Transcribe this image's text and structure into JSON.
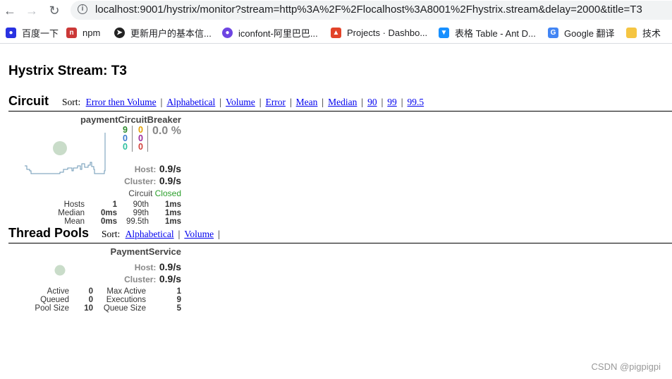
{
  "browser": {
    "url": "localhost:9001/hystrix/monitor?stream=http%3A%2F%2Flocalhost%3A8001%2Fhystrix.stream&delay=2000&title=T3",
    "bookmarks": [
      {
        "label": "百度一下",
        "icon": "baidu-icon"
      },
      {
        "label": "npm",
        "icon": "npm-icon"
      },
      {
        "label": "更新用户的基本信...",
        "icon": "site-icon"
      },
      {
        "label": "iconfont-阿里巴巴...",
        "icon": "iconfont-icon"
      },
      {
        "label": "Projects · Dashbo...",
        "icon": "gitlab-icon"
      },
      {
        "label": "表格 Table - Ant D...",
        "icon": "antd-icon"
      },
      {
        "label": "Google 翻译",
        "icon": "google-translate-icon"
      },
      {
        "label": "技术",
        "icon": "folder-icon"
      }
    ]
  },
  "page": {
    "title": "Hystrix Stream: T3",
    "watermark": "CSDN @pigpigpi"
  },
  "circuit": {
    "heading": "Circuit",
    "sort_label": "Sort:",
    "sort_links": [
      "Error then Volume",
      "Alphabetical",
      "Volume",
      "Error",
      "Mean",
      "Median",
      "90",
      "99",
      "99.5"
    ],
    "card": {
      "name": "paymentCircuitBreaker",
      "counts_left": [
        "9",
        "0",
        "0"
      ],
      "counts_left_colors": [
        "#2c8a2c",
        "#3a7ad0",
        "#2ec0a0"
      ],
      "counts_right": [
        "0",
        "0",
        "0"
      ],
      "counts_right_colors": [
        "#e2a000",
        "#9b2a9b",
        "#d2403a"
      ],
      "error_pct": "0.0 %",
      "host_label": "Host:",
      "host_value": "0.9/s",
      "cluster_label": "Cluster:",
      "cluster_value": "0.9/s",
      "circuit_label": "Circuit",
      "circuit_status": "Closed",
      "stats": [
        [
          "Hosts",
          "1",
          "90th",
          "1ms"
        ],
        [
          "Median",
          "0ms",
          "99th",
          "1ms"
        ],
        [
          "Mean",
          "0ms",
          "99.5th",
          "1ms"
        ]
      ]
    }
  },
  "threadpools": {
    "heading": "Thread Pools",
    "sort_label": "Sort:",
    "sort_links": [
      "Alphabetical",
      "Volume"
    ],
    "card": {
      "name": "PaymentService",
      "host_label": "Host:",
      "host_value": "0.9/s",
      "cluster_label": "Cluster:",
      "cluster_value": "0.9/s",
      "stats": [
        [
          "Active",
          "0",
          "Max Active",
          "1"
        ],
        [
          "Queued",
          "0",
          "Executions",
          "9"
        ],
        [
          "Pool Size",
          "10",
          "Queue Size",
          "5"
        ]
      ]
    }
  }
}
